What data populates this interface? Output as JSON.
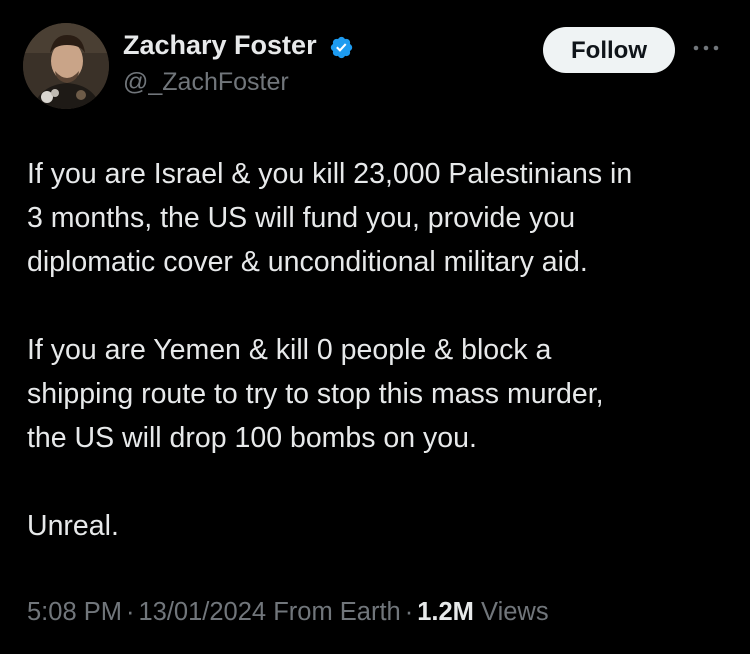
{
  "tweet": {
    "author": {
      "display_name": "Zachary Foster",
      "handle": "@_ZachFoster",
      "verified_icon": "verified-badge-icon",
      "avatar_icon": "avatar-photo"
    },
    "follow_label": "Follow",
    "more_icon": "more-options-icon",
    "paragraphs": [
      "If you are Israel & you kill 23,000 Palestinians in\n3 months, the US will fund you, provide you\ndiplomatic cover & unconditional military aid.",
      "If you are Yemen & kill 0 people & block a\nshipping route to try to stop this mass murder,\nthe US will drop 100 bombs on you.",
      "Unreal."
    ],
    "meta": {
      "time": "5:08 PM",
      "separator": "·",
      "date": "13/01/2024",
      "source": "From Earth",
      "views_count": "1.2M",
      "views_label": "Views"
    }
  },
  "colors": {
    "background": "#000000",
    "primary_text": "#e7e9ea",
    "secondary_text": "#71767b",
    "verified_blue": "#1d9bf0",
    "follow_bg": "#eff3f4",
    "follow_text": "#0f1419"
  }
}
